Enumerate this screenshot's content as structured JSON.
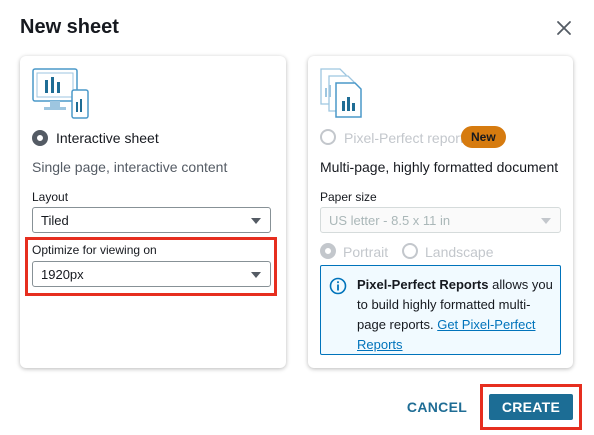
{
  "dialog": {
    "title": "New sheet"
  },
  "interactive": {
    "option_label": "Interactive sheet",
    "description": "Single page, interactive content",
    "layout_label": "Layout",
    "layout_value": "Tiled",
    "optimize_label": "Optimize for viewing on",
    "optimize_value": "1920px"
  },
  "pixel_perfect": {
    "option_label": "Pixel-Perfect report",
    "badge": "New",
    "description": "Multi-page, highly formatted document",
    "paper_size_label": "Paper size",
    "paper_size_value": "US letter - 8.5 x 11 in",
    "orientation_portrait": "Portrait",
    "orientation_landscape": "Landscape",
    "info_bold": "Pixel-Perfect Reports",
    "info_text": " allows you to build highly formatted multi-page reports. ",
    "info_link": "Get Pixel-Perfect Reports"
  },
  "footer": {
    "cancel_label": "CANCEL",
    "create_label": "CREATE"
  },
  "colors": {
    "highlight_red": "#e62e1f",
    "primary_blue": "#1c6d95",
    "badge_orange": "#d67b0f",
    "info_blue": "#0073bb"
  }
}
